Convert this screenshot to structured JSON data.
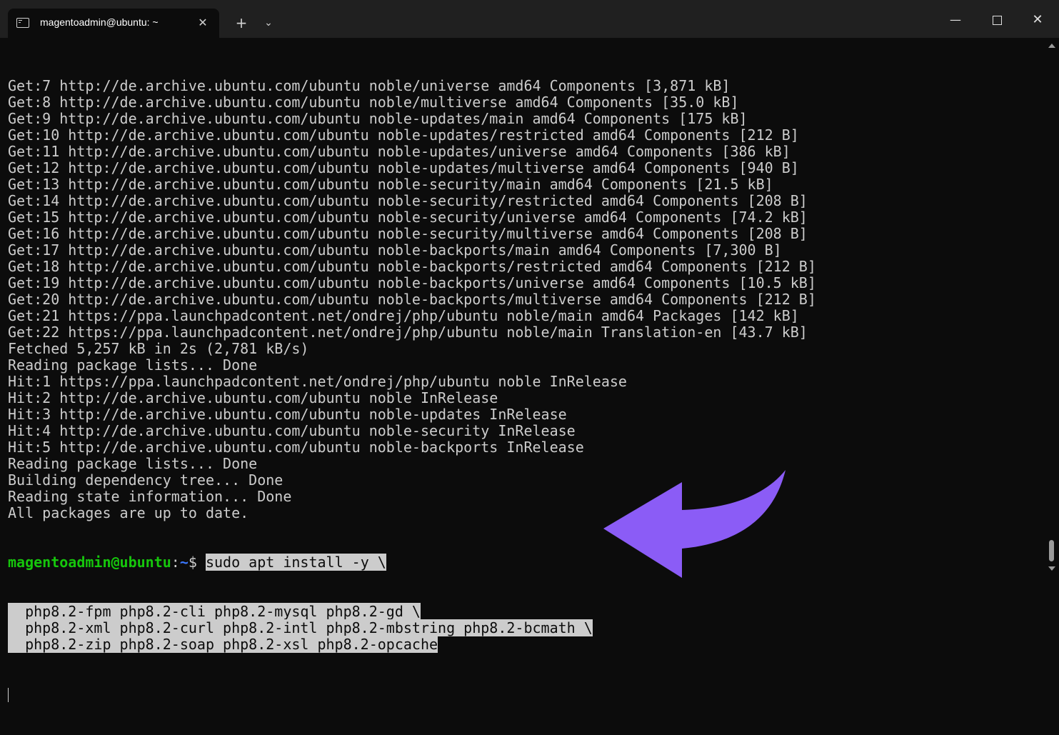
{
  "window": {
    "tab_title": "magentoadmin@ubuntu: ~",
    "tab_close_glyph": "✕",
    "new_tab_glyph": "+",
    "tab_menu_glyph": "⌄",
    "minimize_glyph": "—",
    "close_glyph": "✕"
  },
  "colors": {
    "background": "#0c0c0c",
    "text": "#cccccc",
    "prompt_user": "#16c60c",
    "prompt_path": "#3b78ff",
    "selection": "#cccccc",
    "arrow": "#8b5cf6"
  },
  "output_lines": [
    "Get:7 http://de.archive.ubuntu.com/ubuntu noble/universe amd64 Components [3,871 kB]",
    "Get:8 http://de.archive.ubuntu.com/ubuntu noble/multiverse amd64 Components [35.0 kB]",
    "Get:9 http://de.archive.ubuntu.com/ubuntu noble-updates/main amd64 Components [175 kB]",
    "Get:10 http://de.archive.ubuntu.com/ubuntu noble-updates/restricted amd64 Components [212 B]",
    "Get:11 http://de.archive.ubuntu.com/ubuntu noble-updates/universe amd64 Components [386 kB]",
    "Get:12 http://de.archive.ubuntu.com/ubuntu noble-updates/multiverse amd64 Components [940 B]",
    "Get:13 http://de.archive.ubuntu.com/ubuntu noble-security/main amd64 Components [21.5 kB]",
    "Get:14 http://de.archive.ubuntu.com/ubuntu noble-security/restricted amd64 Components [208 B]",
    "Get:15 http://de.archive.ubuntu.com/ubuntu noble-security/universe amd64 Components [74.2 kB]",
    "Get:16 http://de.archive.ubuntu.com/ubuntu noble-security/multiverse amd64 Components [208 B]",
    "Get:17 http://de.archive.ubuntu.com/ubuntu noble-backports/main amd64 Components [7,300 B]",
    "Get:18 http://de.archive.ubuntu.com/ubuntu noble-backports/restricted amd64 Components [212 B]",
    "Get:19 http://de.archive.ubuntu.com/ubuntu noble-backports/universe amd64 Components [10.5 kB]",
    "Get:20 http://de.archive.ubuntu.com/ubuntu noble-backports/multiverse amd64 Components [212 B]",
    "Get:21 https://ppa.launchpadcontent.net/ondrej/php/ubuntu noble/main amd64 Packages [142 kB]",
    "Get:22 https://ppa.launchpadcontent.net/ondrej/php/ubuntu noble/main Translation-en [43.7 kB]",
    "Fetched 5,257 kB in 2s (2,781 kB/s)",
    "Reading package lists... Done",
    "Hit:1 https://ppa.launchpadcontent.net/ondrej/php/ubuntu noble InRelease",
    "Hit:2 http://de.archive.ubuntu.com/ubuntu noble InRelease",
    "Hit:3 http://de.archive.ubuntu.com/ubuntu noble-updates InRelease",
    "Hit:4 http://de.archive.ubuntu.com/ubuntu noble-security InRelease",
    "Hit:5 http://de.archive.ubuntu.com/ubuntu noble-backports InRelease",
    "Reading package lists... Done",
    "Building dependency tree... Done",
    "Reading state information... Done",
    "All packages are up to date."
  ],
  "prompt": {
    "user": "magentoadmin@ubuntu",
    "colon": ":",
    "path": "~",
    "dollar": "$ ",
    "command": "sudo apt install -y \\"
  },
  "selected_lines": [
    "  php8.2-fpm php8.2-cli php8.2-mysql php8.2-gd \\",
    "  php8.2-xml php8.2-curl php8.2-intl php8.2-mbstring php8.2-bcmath \\",
    "  php8.2-zip php8.2-soap php8.2-xsl php8.2-opcache"
  ]
}
